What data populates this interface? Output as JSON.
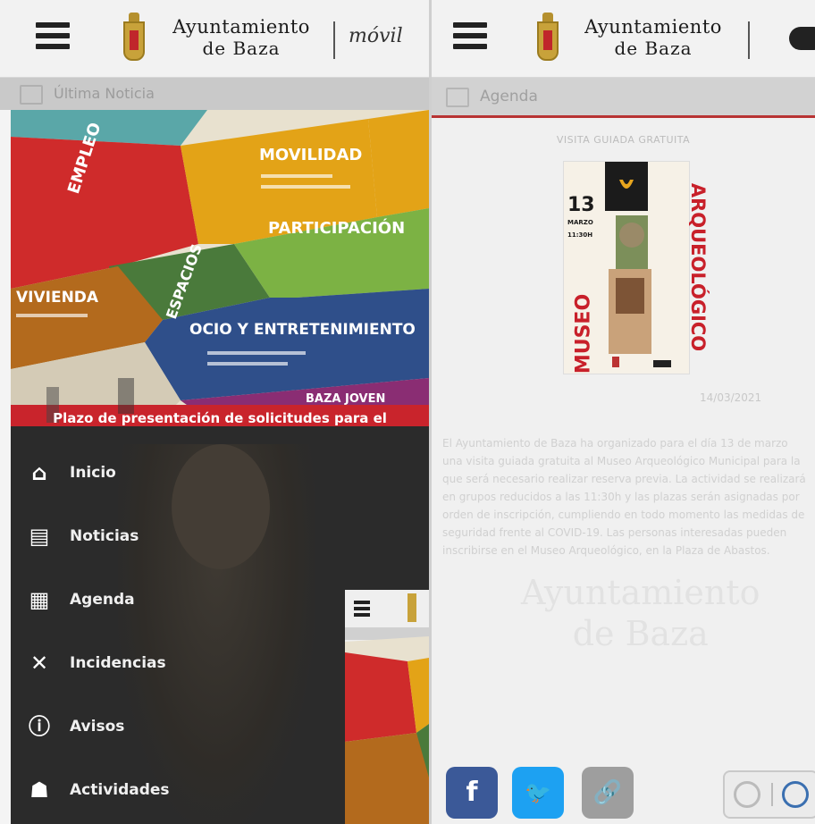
{
  "left_panel": {
    "brand_line1": "Ayuntamiento",
    "brand_line2": "de Baza",
    "brand_suffix": "móvil",
    "section_title": "Última Noticia",
    "banner_tiles": {
      "empleo": "EMPLEO",
      "movilidad": "MOVILIDAD",
      "participacion": "PARTICIPACIÓN",
      "espacios": "ESPACIOS",
      "vivienda": "VIVIENDA",
      "ocio": "OCIO Y ENTRETENIMIENTO",
      "joven": "BAZA JOVEN"
    },
    "banner_caption": "Plazo de presentación de solicitudes para el",
    "menu_items": [
      {
        "label": "Inicio",
        "icon": "home-icon"
      },
      {
        "label": "Noticias",
        "icon": "newspaper-icon"
      },
      {
        "label": "Agenda",
        "icon": "calendar-icon"
      },
      {
        "label": "Incidencias",
        "icon": "tools-icon"
      },
      {
        "label": "Avisos",
        "icon": "alert-icon"
      },
      {
        "label": "Actividades",
        "icon": "people-icon"
      }
    ]
  },
  "right_panel": {
    "brand_line1": "Ayuntamiento",
    "brand_line2": "de Baza",
    "section_title": "Agenda",
    "event_heading": "VISITA GUIADA GRATUITA",
    "poster": {
      "day": "13",
      "month": "MARZO",
      "time": "11:30H",
      "word1": "MUSEO",
      "word2": "ARQUEOLÓGICO"
    },
    "date": "14/03/2021",
    "description": "El Ayuntamiento de Baza ha organizado para el día 13 de marzo una visita guiada gratuita al Museo Arqueológico Municipal para la que será necesario realizar reserva previa. La actividad se realizará en grupos reducidos a las 11:30h y las plazas serán asignadas por orden de inscripción, cumpliendo en todo momento las medidas de seguridad frente al COVID-19. Las personas interesadas pueden inscribirse en el Museo Arqueológico, en la Plaza de Abastos.",
    "watermark_line1": "Ayuntamiento",
    "watermark_line2": "de Baza",
    "social": {
      "facebook": "f",
      "twitter": "t",
      "link": "link"
    }
  },
  "colors": {
    "accent_red": "#b83333",
    "facebook": "#3b5998",
    "twitter": "#1da1f2",
    "link": "#9e9e9e",
    "menu_bg": "#2b2b2b"
  }
}
